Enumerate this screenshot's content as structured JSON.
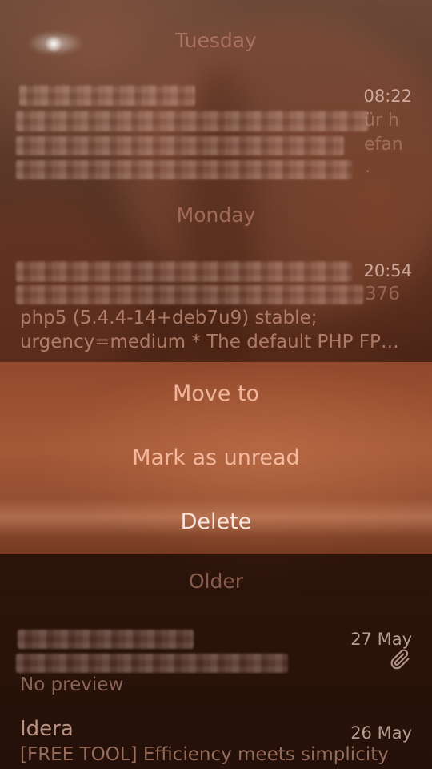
{
  "sections": {
    "tuesday": "Tuesday",
    "monday": "Monday",
    "older": "Older"
  },
  "messages": [
    {
      "time": "08:22",
      "visible_fragments": [
        "ür h",
        "efan",
        "."
      ]
    },
    {
      "time": "20:54",
      "visible_fragments": [
        "376"
      ],
      "preview_line1": "php5 (5.4.4-14+deb7u9) stable;",
      "preview_line2": "urgency=medium * The default PHP FP…"
    },
    {
      "time": "27 May",
      "preview": "No preview",
      "has_attachment": true
    },
    {
      "sender": "Idera",
      "time": "26 May",
      "preview": "[FREE TOOL] Efficiency meets simplicity"
    }
  ],
  "context_menu": {
    "items": [
      "Move to",
      "Mark as unread",
      "Delete"
    ],
    "highlighted": "Delete"
  },
  "icons": {
    "attachment": "paperclip-icon"
  },
  "colors": {
    "accent": "#d89070",
    "menu_background": "#a85a38",
    "highlight_text": "#fff0e8"
  }
}
